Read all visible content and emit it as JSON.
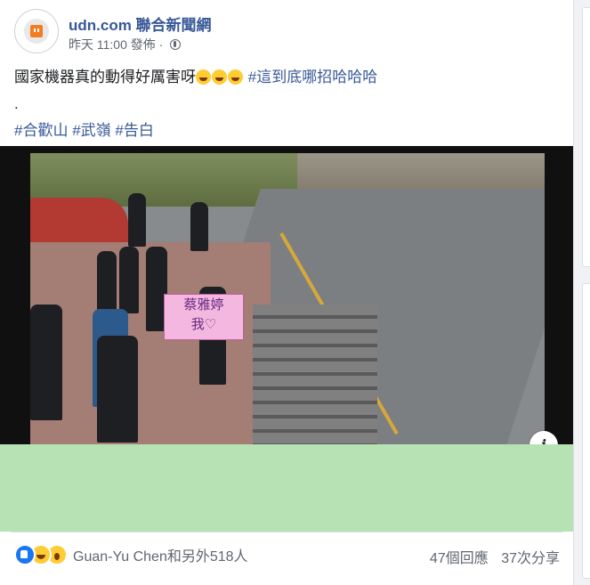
{
  "post": {
    "page_name": "udn.com 聯合新聞網",
    "timestamp": "昨天 11:00",
    "published_label": "發佈",
    "separator": "·",
    "privacy_icon": "globe-icon",
    "text_line1": "國家機器真的動得好厲害呀",
    "text_line1_hashtag": "#這到底哪招哈哈哈",
    "text_dot": ".",
    "hashtags": [
      "#合歡山",
      "#武嶺",
      "#告白"
    ],
    "emoji_icon": "laughing-tears-emoji"
  },
  "media": {
    "banner_line1": "蔡雅婷",
    "banner_line2": "我♡",
    "info_icon_label": "i",
    "placeholder_color": "#b7e3b4"
  },
  "footer": {
    "reaction_icons": [
      "like-icon",
      "haha-icon",
      "wow-icon"
    ],
    "reaction_text": "Guan-Yu Chen和另外518人",
    "comments": "47個回應",
    "shares": "37次分享"
  },
  "colors": {
    "link": "#385898",
    "muted": "#606770",
    "like_blue": "#1877f2"
  }
}
